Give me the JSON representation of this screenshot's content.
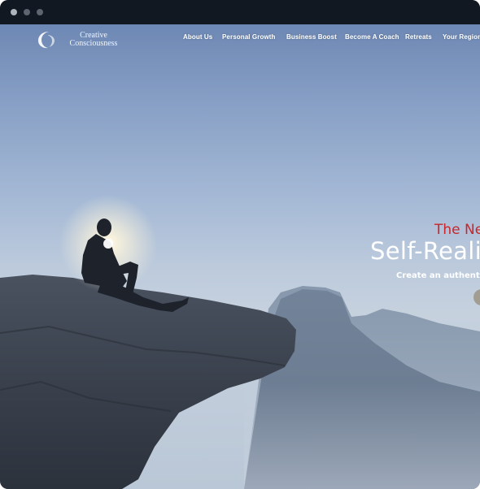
{
  "browser": {
    "window_dots": [
      "close",
      "minimize",
      "maximize"
    ]
  },
  "brand": {
    "line1": "Creative",
    "line2": "Consciousness",
    "logo_icon": "crescent-swirl-icon"
  },
  "nav": {
    "items": [
      {
        "label": "About Us"
      },
      {
        "label": "Personal Growth"
      },
      {
        "label": "Business Boost"
      },
      {
        "label": "Become A Coach"
      },
      {
        "label": "Retreats"
      },
      {
        "label": "Your Region"
      }
    ]
  },
  "hero": {
    "kicker": "The Ne",
    "headline": "Self-Reali",
    "subline": "Create an authentic l"
  },
  "colors": {
    "accent_red": "#c8262b",
    "chrome": "#111822",
    "sky_top": "#6d88b4",
    "sky_horizon": "#c6d1de"
  }
}
